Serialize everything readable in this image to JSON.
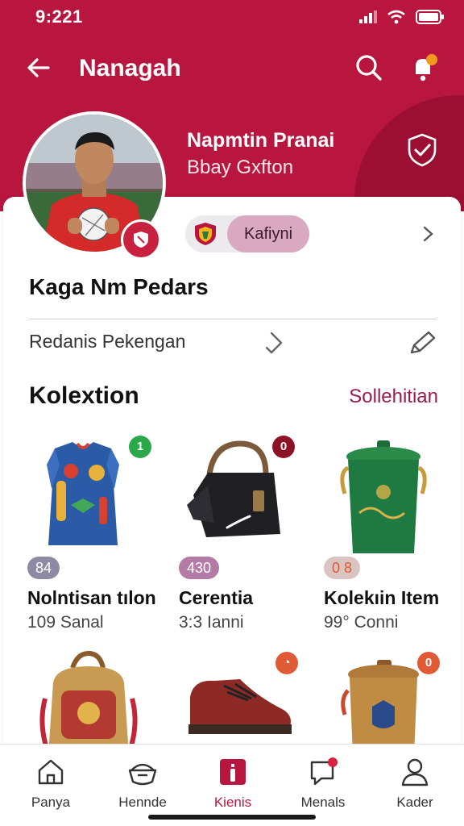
{
  "status_bar": {
    "time": "9:221"
  },
  "app_bar": {
    "title": "Nanagah"
  },
  "profile": {
    "name": "Napmtin Pranai",
    "subtitle": "Bbay Gxfton",
    "team_chip": "Kafiyni",
    "headline": "Kaga Nm Pedars",
    "subrow_label": "Redanis Pekengan"
  },
  "collection": {
    "title": "Kolextion",
    "link": "Sollehitian",
    "items": [
      {
        "name": "Nolntisan tılon",
        "meta": "109 Sanal",
        "price": "84",
        "badge": "1",
        "badge_color": "#2aa84a",
        "price_color": "#8d8aa3"
      },
      {
        "name": "Cerentia",
        "meta": "3:3 Ianni",
        "price": "430",
        "badge": "0",
        "badge_color": "#8d1228",
        "price_color": "#b37ba5"
      },
      {
        "name": "Kolekıin Item",
        "meta": "99° Conni",
        "price": "0 8",
        "badge": "",
        "badge_color": "",
        "price_color": "#d9c3c3"
      },
      {
        "name": "",
        "meta": "",
        "price": "",
        "badge": "",
        "badge_color": "",
        "price_color": ""
      },
      {
        "name": "",
        "meta": "",
        "price": "",
        "badge": "",
        "badge_color": "#e05a36",
        "price_color": ""
      },
      {
        "name": "",
        "meta": "",
        "price": "",
        "badge": "0",
        "badge_color": "#e05a36",
        "price_color": ""
      }
    ]
  },
  "bottom_nav": [
    {
      "label": "Panya",
      "icon": "home-icon"
    },
    {
      "label": "Hennde",
      "icon": "basket-icon"
    },
    {
      "label": "Kienis",
      "icon": "collection-icon",
      "active": true
    },
    {
      "label": "Menals",
      "icon": "chat-icon"
    },
    {
      "label": "Kader",
      "icon": "profile-icon"
    }
  ],
  "colors": {
    "brand": "#b8163e",
    "brand_dark": "#9c0f33",
    "link": "#9b1b4a"
  }
}
